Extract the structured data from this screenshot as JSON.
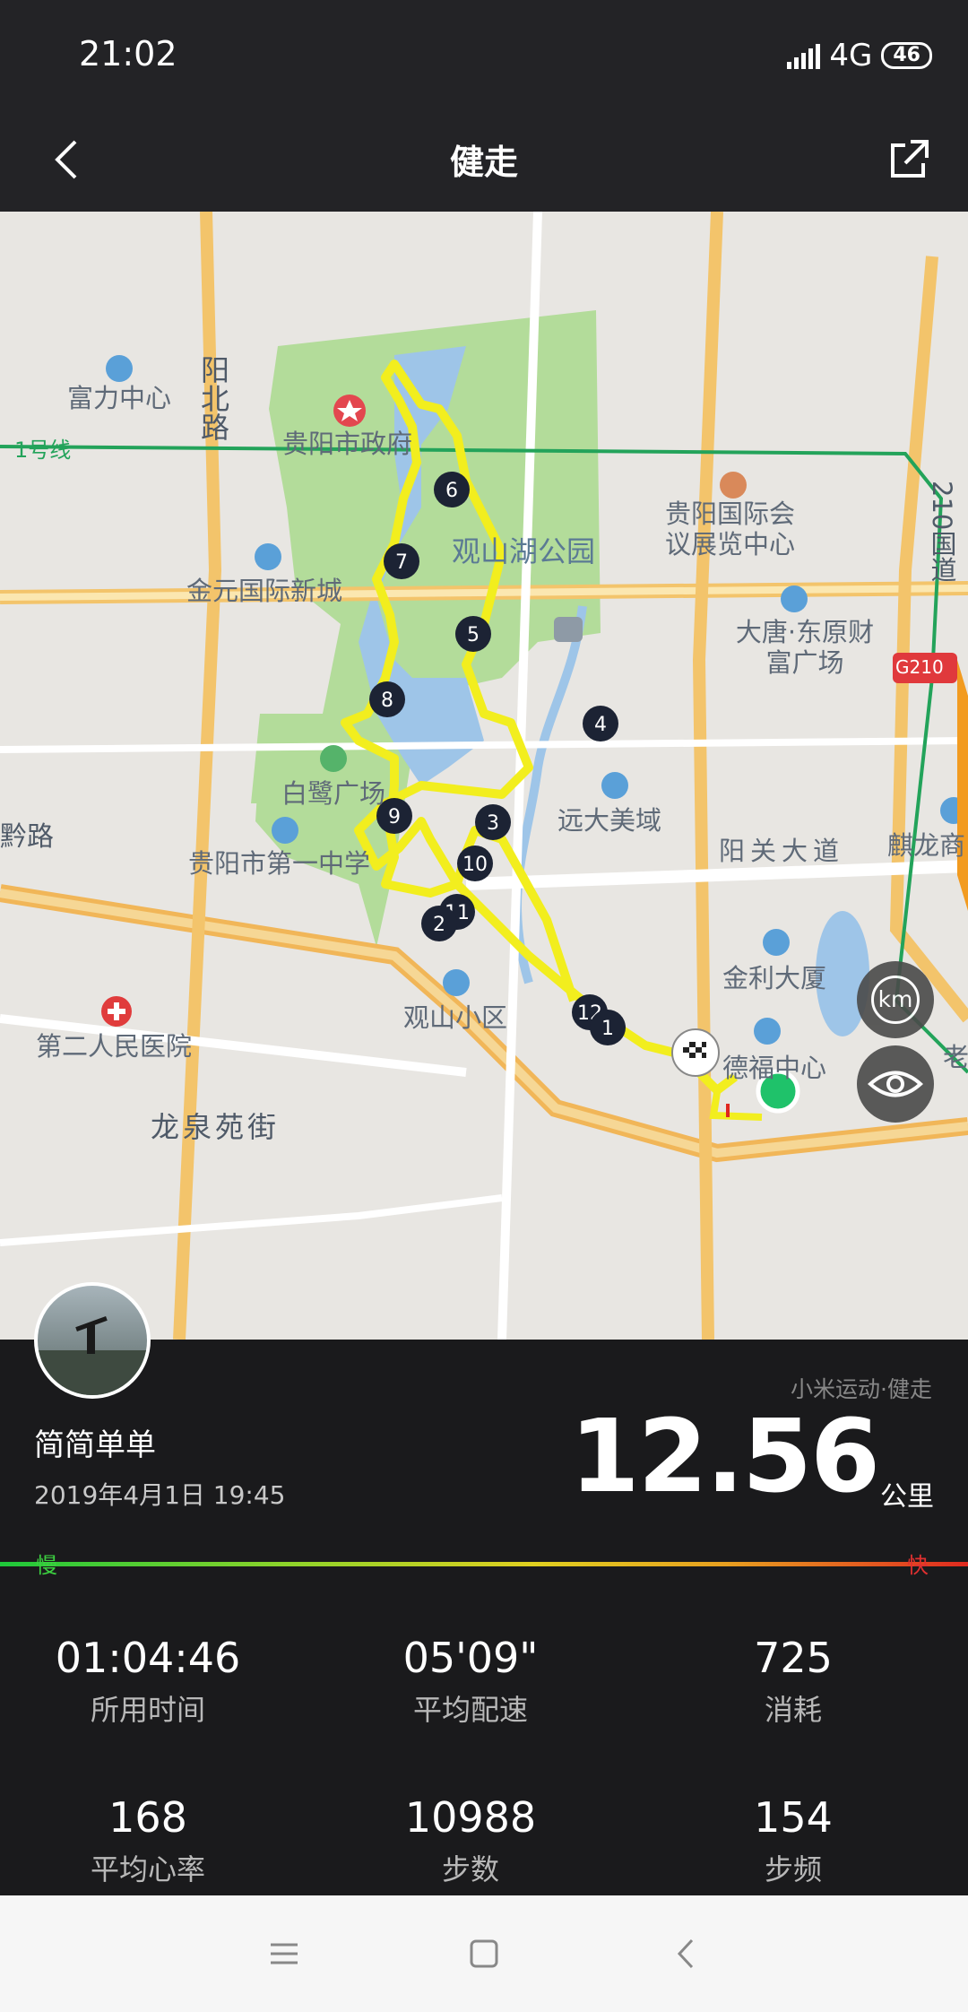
{
  "status": {
    "time": "21:02",
    "network": "4G",
    "battery": "46"
  },
  "header": {
    "title": "健走"
  },
  "map": {
    "labels": {
      "fuli": "富力中心",
      "yangbei": "阳北路",
      "gov": "贵阳市政府",
      "line1": "1号线",
      "expo": "贵阳国际会议展览中心",
      "g210v": "210国道",
      "park": "观山湖公园",
      "jinyuan": "金元国际新城",
      "datang": "大唐·东原财富广场",
      "g210badge": "G210",
      "bailu": "白鹭广场",
      "yuanda": "远大美域",
      "yangguan": "阳关大道",
      "qilong": "麒龙商",
      "school": "贵阳市第一中学",
      "road_left": "黔路",
      "jinli": "金利大厦",
      "guanshan": "观山小区",
      "hospital": "第二人民医院",
      "defu": "德福中心",
      "longquan": "龙泉苑街",
      "lao": "老",
      "km_button": "km"
    },
    "markers": [
      "1",
      "2",
      "3",
      "4",
      "5",
      "6",
      "7",
      "8",
      "9",
      "10",
      "11",
      "12"
    ]
  },
  "workout": {
    "source": "小米运动·健走",
    "user": "简简单单",
    "datetime": "2019年4月1日 19:45",
    "distance": "12.56",
    "unit": "公里",
    "slow_label": "慢",
    "fast_label": "快"
  },
  "stats": [
    {
      "value": "01:04:46",
      "label": "所用时间"
    },
    {
      "value": "05'09\"",
      "label": "平均配速"
    },
    {
      "value": "725",
      "label": "消耗"
    },
    {
      "value": "168",
      "label": "平均心率"
    },
    {
      "value": "10988",
      "label": "步数"
    },
    {
      "value": "154",
      "label": "步频"
    }
  ],
  "colors": {
    "route": "#f2ee1e",
    "park": "#a6d58e",
    "water": "#9dc3e6",
    "start": "#1fc26a"
  }
}
